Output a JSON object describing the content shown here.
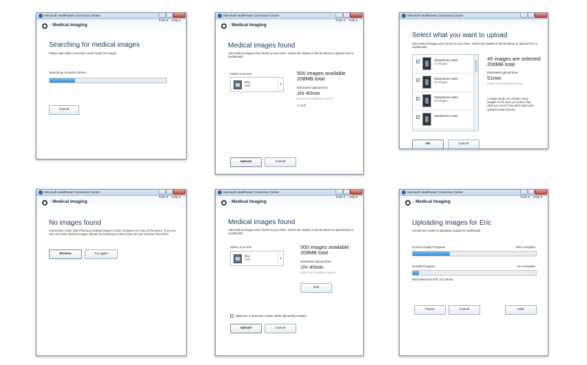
{
  "window_title": "Microsoft HealthVault Connection Center",
  "breadcrumb": "Medical Imaging",
  "menu": {
    "tools": "Tools ▾",
    "help": "Help ▾"
  },
  "home_icon": "home-icon",
  "screens": {
    "searching": {
      "heading": "Searching for medical images",
      "subtitle": "Please wait while connection center looks for images",
      "status": "Searching computer drives ...",
      "progress_pct": 22,
      "cancel": "Cancel"
    },
    "found": {
      "heading": "Medical images found",
      "subtitle": "108 medical images were found on your drive. Select the studies in the list below to upload then to HealthVault",
      "select_record_label": "Select a record:",
      "record_name": "Eric",
      "record_rel": "Self",
      "available": "500 images available",
      "total": "208MB total",
      "est_label": "Estimated upload time:",
      "est_value": "1hr 40min",
      "speed_note": "based on broadband speed",
      "edit": "Edit",
      "upload": "Upload",
      "cancel": "Cancel"
    },
    "select": {
      "heading": "Select what you want to upload",
      "subtitle": "108 medical images were found on your drive. Select the studies in the list below to upload then to HealthVault",
      "items": [
        {
          "name": "Study/series name",
          "count": "15 images"
        },
        {
          "name": "Study/series name",
          "count": "15 images"
        },
        {
          "name": "Study/series name",
          "count": "16 images"
        },
        {
          "name": "Study/series name",
          "count": ""
        }
      ],
      "selected_count": "45 images are selected",
      "selected_total": "208MB total",
      "est_label": "Estimated upload time:",
      "est_value": "51min",
      "speed_note": "based on broadband speed",
      "tip": "A single study can contain many images so be sure you select only what you need if you don't want your upload to take forever.",
      "ok": "OK",
      "cancel": "Cancel"
    },
    "none": {
      "heading": "No images found",
      "body": "Connection center didn't find any medical images on this computer or in any of the drives. If you are sure you have medical images, please try browsing to where they are and continue from there",
      "browse": "Browse",
      "try_again": "Try again"
    },
    "found2": {
      "heading": "Medical images found",
      "subtitle": "108 medical images were found on your drive. Select the studies in the list below to upload then to HealthVault",
      "select_record_label": "Select a record:",
      "record_name": "Eric",
      "record_rel": "Self",
      "available": "500 images available",
      "total": "208MB total",
      "est_label": "Estimated upload time:",
      "est_value": "1hr 40min",
      "speed_note": "based on broadband speed",
      "edit": "Edit",
      "minimize_label": "Minimize connection center while uploading images",
      "upload": "Upload",
      "cancel": "Cancel"
    },
    "uploading": {
      "heading": "Uploading Images for Eric",
      "subtitle": "Connection center is uploading images to HealthVault",
      "current_label": "Current Image Progress",
      "current_pct_text": "30% complete",
      "current_pct": 30,
      "overall_label": "Overall Progress",
      "overall_pct_text": "5% complete",
      "overall_pct": 5,
      "time_left": "Estimated time left:  1hr 20min",
      "pause": "Pause",
      "cancel": "Cancel",
      "hide": "Hide"
    }
  }
}
